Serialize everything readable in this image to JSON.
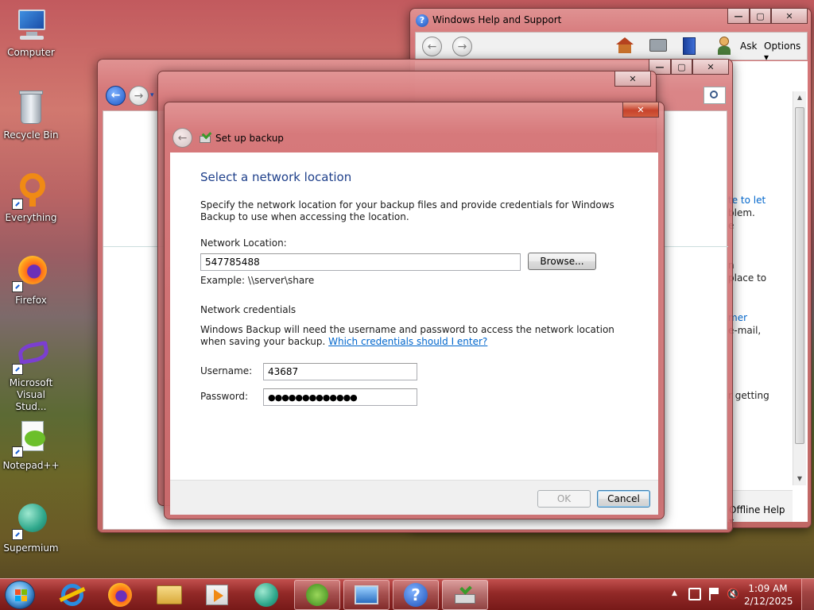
{
  "desktop": {
    "icons": [
      {
        "label": "Computer",
        "icon": "computer-icon"
      },
      {
        "label": "Recycle Bin",
        "icon": "recycle-bin-icon"
      },
      {
        "label": "Everything",
        "icon": "everything-icon"
      },
      {
        "label": "Firefox",
        "icon": "firefox-icon"
      },
      {
        "label": "Microsoft Visual Stud...",
        "icon": "visual-studio-icon"
      },
      {
        "label": "Notepad++",
        "icon": "notepadpp-icon"
      },
      {
        "label": "Supermium",
        "icon": "supermium-icon"
      }
    ]
  },
  "help_window": {
    "title": "Windows Help and Support",
    "ask": "Ask",
    "options": "Options",
    "offline_help": "Offline Help",
    "side_fragments": [
      "te to let",
      "blem.",
      "e",
      "n",
      "place to",
      "mer",
      "e-mail,",
      "r getting"
    ]
  },
  "dialog": {
    "title": "Set up backup",
    "heading": "Select a network location",
    "intro": "Specify the network location for your backup files and provide credentials for Windows Backup to use when accessing the location.",
    "network_location_label": "Network Location:",
    "network_location_value": "547785488",
    "browse_label": "Browse...",
    "example": "Example: \\\\server\\share",
    "credentials_heading": "Network credentials",
    "credentials_text": "Windows Backup will need the username and password to access the network location when saving your backup.",
    "credentials_link": "Which credentials should I enter?",
    "username_label": "Username:",
    "username_value": "43687",
    "password_label": "Password:",
    "password_value": "●●●●●●●●●●●●●",
    "ok_label": "OK",
    "cancel_label": "Cancel"
  },
  "taskbar": {
    "apps": [
      "start-orb",
      "internet-explorer-icon",
      "firefox-icon",
      "file-explorer-icon",
      "media-player-icon",
      "supermium-icon",
      "windows-update-icon",
      "remote-desktop-icon",
      "help-icon",
      "backup-icon"
    ],
    "time": "1:09 AM",
    "date": "2/12/2025"
  }
}
